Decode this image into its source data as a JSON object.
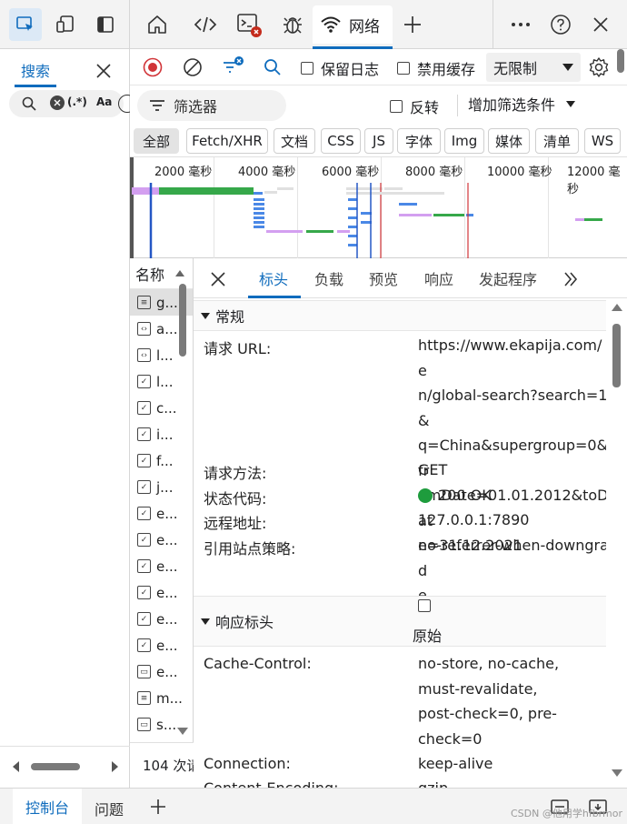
{
  "top_tabs": {
    "network_label": "网络"
  },
  "left_pane": {
    "search_tab_label": "搜索",
    "regex_label": "(.*)",
    "case_label": "Aa"
  },
  "toolbar": {
    "preserve_log_label": "保留日志",
    "disable_cache_label": "禁用缓存",
    "throttle_value": "无限制"
  },
  "filter": {
    "placeholder": "筛选器",
    "invert_label": "反转",
    "more_filters_label": "增加筛选条件"
  },
  "type_chips": [
    "全部",
    "Fetch/XHR",
    "文档",
    "CSS",
    "JS",
    "字体",
    "Img",
    "媒体",
    "清单",
    "WS"
  ],
  "overview": {
    "ticks": [
      "2000 毫秒",
      "4000 毫秒",
      "6000 毫秒",
      "8000 毫秒",
      "10000 毫秒",
      "12000 毫秒"
    ]
  },
  "name_list": {
    "header": "名称",
    "rows": [
      {
        "name": "g...",
        "icon": "document-icon",
        "selected": true
      },
      {
        "name": "a...",
        "icon": "code-icon"
      },
      {
        "name": "l...",
        "icon": "code-icon"
      },
      {
        "name": "l...",
        "icon": "script-icon"
      },
      {
        "name": "c...",
        "icon": "script-icon"
      },
      {
        "name": "i...",
        "icon": "script-icon"
      },
      {
        "name": "f...",
        "icon": "script-icon"
      },
      {
        "name": "j...",
        "icon": "script-icon"
      },
      {
        "name": "e...",
        "icon": "script-icon"
      },
      {
        "name": "e...",
        "icon": "script-icon"
      },
      {
        "name": "e...",
        "icon": "script-icon"
      },
      {
        "name": "e...",
        "icon": "script-icon"
      },
      {
        "name": "e...",
        "icon": "script-icon"
      },
      {
        "name": "e...",
        "icon": "script-icon"
      },
      {
        "name": "e...",
        "icon": "image-icon"
      },
      {
        "name": "m...",
        "icon": "text-icon"
      },
      {
        "name": "s...",
        "icon": "image-icon"
      }
    ],
    "status": "104 次请"
  },
  "details": {
    "tabs": [
      "标头",
      "负载",
      "预览",
      "响应",
      "发起程序"
    ],
    "general": {
      "title": "常规",
      "request_url_key": "请求 URL:",
      "request_url_lines": [
        "https://www.ekapija.com/e",
        "n/global-search?search=1&",
        "q=China&supergroup=0&fr",
        "omDate=01.01.2012&toDat",
        "e=31.12.2021"
      ],
      "method_key": "请求方法:",
      "method_val": "GET",
      "status_key": "状态代码:",
      "status_val": "200 OK",
      "status_color": "#1e9c3d",
      "remote_key": "远程地址:",
      "remote_val": "127.0.0.1:7890",
      "referrer_key": "引用站点策略:",
      "referrer_lines": [
        "no-referrer-when-downgrad",
        "e"
      ]
    },
    "response_headers": {
      "title": "响应标头",
      "raw_label": "原始",
      "cache_key": "Cache-Control:",
      "cache_lines": [
        "no-store, no-cache,",
        "must-revalidate,",
        "post-check=0, pre-",
        "check=0"
      ],
      "connection_key": "Connection:",
      "connection_val": "keep-alive",
      "encoding_key": "Content-Encoding:",
      "encoding_val": "gzip"
    }
  },
  "drawer": {
    "console_label": "控制台",
    "issues_label": "问题"
  },
  "watermark": "CSDN @他用学hfbrmor",
  "colors": {
    "accent": "#0f6cbd",
    "record_red": "#d13438"
  }
}
